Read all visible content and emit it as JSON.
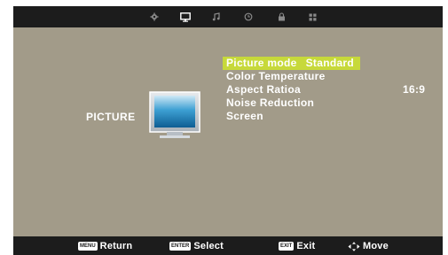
{
  "topbar": {
    "tabs": [
      {
        "icon": "gear-icon"
      },
      {
        "icon": "monitor-icon"
      },
      {
        "icon": "music-note-icon"
      },
      {
        "icon": "clock-icon"
      },
      {
        "icon": "lock-icon"
      },
      {
        "icon": "grid-icon"
      }
    ]
  },
  "section": {
    "label": "PICTURE"
  },
  "menu": {
    "items": [
      {
        "label": "Picture mode",
        "value": "Standard",
        "selected": true
      },
      {
        "label": "Color Temperature"
      },
      {
        "label": "Aspect Ratioa",
        "value": "16:9"
      },
      {
        "label": "Noise Reduction"
      },
      {
        "label": "Screen"
      }
    ]
  },
  "bottombar": {
    "return": {
      "key": "MENU",
      "label": "Return"
    },
    "select": {
      "key": "ENTER",
      "label": "Select"
    },
    "exit": {
      "key": "EXIT",
      "label": "Exit"
    },
    "move": {
      "label": "Move"
    }
  },
  "colors": {
    "background": "#a29b89",
    "bar": "#1c1c1c",
    "highlight": "#c7d93a",
    "text": "#ffffff"
  }
}
